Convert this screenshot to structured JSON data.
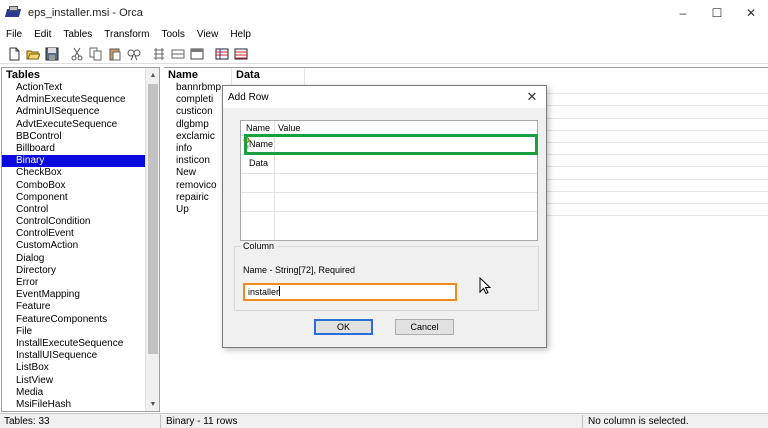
{
  "window": {
    "title": "eps_installer.msi - Orca",
    "minimize": "–",
    "maximize": "☐",
    "close": "✕"
  },
  "menu": [
    "File",
    "Edit",
    "Tables",
    "Transform",
    "Tools",
    "View",
    "Help"
  ],
  "toolbar": {
    "icons": [
      "new-icon",
      "open-icon",
      "save-icon",
      "cut-icon",
      "copy-icon",
      "paste-icon",
      "find-icon",
      "table-icon",
      "add-row-icon",
      "tables-icon",
      "validate-icon",
      "merge-icon"
    ]
  },
  "tables": {
    "header": "Tables",
    "items": [
      "ActionText",
      "AdminExecuteSequence",
      "AdminUISequence",
      "AdvtExecuteSequence",
      "BBControl",
      "Billboard",
      "Binary",
      "CheckBox",
      "ComboBox",
      "Component",
      "Control",
      "ControlCondition",
      "ControlEvent",
      "CustomAction",
      "Dialog",
      "Directory",
      "Error",
      "EventMapping",
      "Feature",
      "FeatureComponents",
      "File",
      "InstallExecuteSequence",
      "InstallUISequence",
      "ListBox",
      "ListView",
      "Media",
      "MsiFileHash"
    ],
    "selected": "Binary"
  },
  "rows": {
    "columns": [
      "Name",
      "Data"
    ],
    "names": [
      "bannrbmp",
      "completi",
      "custicon",
      "dlgbmp",
      "exclamic",
      "info",
      "insticon",
      "New",
      "removico",
      "repairic",
      "Up"
    ]
  },
  "status": {
    "tables_count": "Tables: 33",
    "table_info": "Binary - 11 rows",
    "column_info": "No column is selected."
  },
  "dialog": {
    "title": "Add Row",
    "close": "✕",
    "list_headers": {
      "name": "Name",
      "value": "Value"
    },
    "fields": [
      {
        "name": "Name",
        "value": ""
      },
      {
        "name": "Data",
        "value": ""
      }
    ],
    "column_group_label": "Column",
    "column_desc": "Name - String[72], Required",
    "input_value": "installer",
    "ok_label": "OK",
    "cancel_label": "Cancel"
  },
  "colors": {
    "selection": "#0a0adf",
    "highlight_green": "#1aa040",
    "highlight_orange": "#ee8a1f",
    "ok_border": "#2a6fd6"
  }
}
